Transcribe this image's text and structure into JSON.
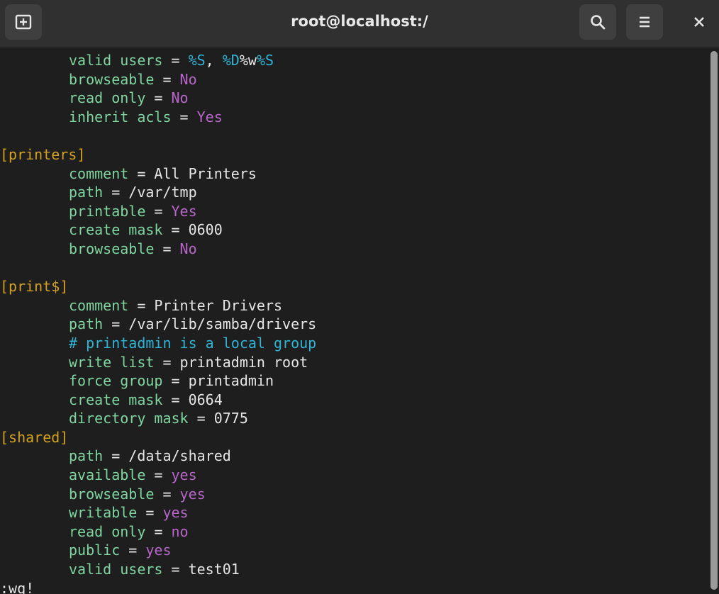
{
  "window": {
    "title": "root@localhost:/"
  },
  "toolbar": {
    "new_tab_icon": "new-tab-icon",
    "search_icon": "search-icon",
    "menu_icon": "hamburger-menu-icon",
    "close_icon": "close-icon"
  },
  "lines": [
    [
      {
        "t": "valid users",
        "c": "k"
      },
      {
        "t": " = ",
        "c": "s"
      },
      {
        "t": "%S",
        "c": "c"
      },
      {
        "t": ", ",
        "c": "s"
      },
      {
        "t": "%D",
        "c": "c"
      },
      {
        "t": "%w",
        "c": "s"
      },
      {
        "t": "%S",
        "c": "c"
      }
    ],
    [
      {
        "t": "browseable",
        "c": "k"
      },
      {
        "t": " = ",
        "c": "s"
      },
      {
        "t": "No",
        "c": "v"
      }
    ],
    [
      {
        "t": "read only",
        "c": "k"
      },
      {
        "t": " = ",
        "c": "s"
      },
      {
        "t": "No",
        "c": "v"
      }
    ],
    [
      {
        "t": "inherit acls",
        "c": "k"
      },
      {
        "t": " = ",
        "c": "s"
      },
      {
        "t": "Yes",
        "c": "v"
      }
    ],
    [],
    [
      {
        "t": "[printers]",
        "c": "sec",
        "sec": true
      }
    ],
    [
      {
        "t": "comment",
        "c": "k"
      },
      {
        "t": " = ",
        "c": "s"
      },
      {
        "t": "All Printers",
        "c": "s"
      }
    ],
    [
      {
        "t": "path",
        "c": "k"
      },
      {
        "t": " = ",
        "c": "s"
      },
      {
        "t": "/var/tmp",
        "c": "s"
      }
    ],
    [
      {
        "t": "printable",
        "c": "k"
      },
      {
        "t": " = ",
        "c": "s"
      },
      {
        "t": "Yes",
        "c": "v"
      }
    ],
    [
      {
        "t": "create mask",
        "c": "k"
      },
      {
        "t": " = ",
        "c": "s"
      },
      {
        "t": "0600",
        "c": "s"
      }
    ],
    [
      {
        "t": "browseable",
        "c": "k"
      },
      {
        "t": " = ",
        "c": "s"
      },
      {
        "t": "No",
        "c": "v"
      }
    ],
    [],
    [
      {
        "t": "[print$]",
        "c": "sec",
        "sec": true
      }
    ],
    [
      {
        "t": "comment",
        "c": "k"
      },
      {
        "t": " = ",
        "c": "s"
      },
      {
        "t": "Printer Drivers",
        "c": "s"
      }
    ],
    [
      {
        "t": "path",
        "c": "k"
      },
      {
        "t": " = ",
        "c": "s"
      },
      {
        "t": "/var/lib/samba/drivers",
        "c": "s"
      }
    ],
    [
      {
        "t": "# printadmin is a local group",
        "c": "c"
      }
    ],
    [
      {
        "t": "write list",
        "c": "k"
      },
      {
        "t": " = ",
        "c": "s"
      },
      {
        "t": "printadmin root",
        "c": "s"
      }
    ],
    [
      {
        "t": "force group",
        "c": "k"
      },
      {
        "t": " = ",
        "c": "s"
      },
      {
        "t": "printadmin",
        "c": "s"
      }
    ],
    [
      {
        "t": "create mask",
        "c": "k"
      },
      {
        "t": " = ",
        "c": "s"
      },
      {
        "t": "0664",
        "c": "s"
      }
    ],
    [
      {
        "t": "directory mask",
        "c": "k"
      },
      {
        "t": " = ",
        "c": "s"
      },
      {
        "t": "0775",
        "c": "s"
      }
    ],
    [
      {
        "t": "[shared]",
        "c": "sec",
        "sec": true
      }
    ],
    [
      {
        "t": "path",
        "c": "k"
      },
      {
        "t": " = ",
        "c": "s"
      },
      {
        "t": "/data/shared",
        "c": "s"
      }
    ],
    [
      {
        "t": "available",
        "c": "k"
      },
      {
        "t": " = ",
        "c": "s"
      },
      {
        "t": "yes",
        "c": "v"
      }
    ],
    [
      {
        "t": "browseable",
        "c": "k"
      },
      {
        "t": " = ",
        "c": "s"
      },
      {
        "t": "yes",
        "c": "v"
      }
    ],
    [
      {
        "t": "writable",
        "c": "k"
      },
      {
        "t": " = ",
        "c": "s"
      },
      {
        "t": "yes",
        "c": "v"
      }
    ],
    [
      {
        "t": "read only",
        "c": "k"
      },
      {
        "t": " = ",
        "c": "s"
      },
      {
        "t": "no",
        "c": "v"
      }
    ],
    [
      {
        "t": "public",
        "c": "k"
      },
      {
        "t": " = ",
        "c": "s"
      },
      {
        "t": "yes",
        "c": "v"
      }
    ],
    [
      {
        "t": "valid users",
        "c": "k"
      },
      {
        "t": " = ",
        "c": "s"
      },
      {
        "t": "test01",
        "c": "s"
      }
    ],
    [
      {
        "t": ":wq!",
        "c": "s",
        "sec": true
      }
    ]
  ],
  "colors": {
    "key": "#7fd5a0",
    "value": "#b866c9",
    "comment": "#2fb4d6",
    "section": "#d3a020",
    "text": "#e6e6e6",
    "background": "#1e1e1e"
  }
}
